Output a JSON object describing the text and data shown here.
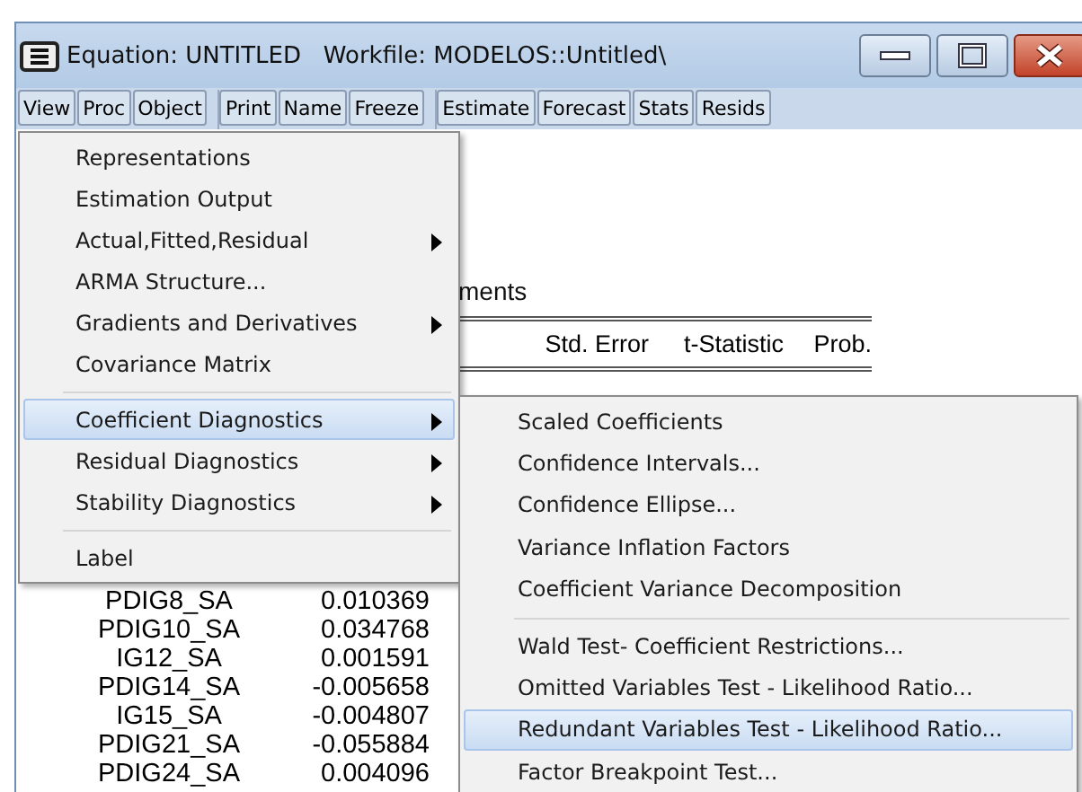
{
  "window": {
    "title": "Equation: UNTITLED   Workfile: MODELOS::Untitled\\"
  },
  "toolbar": [
    {
      "buttons": [
        "View",
        "Proc",
        "Object"
      ]
    },
    {
      "buttons": [
        "Print",
        "Name",
        "Freeze"
      ]
    },
    {
      "buttons": [
        "Estimate",
        "Forecast",
        "Stats",
        "Resids"
      ]
    }
  ],
  "output": {
    "heading_fragment": "ments",
    "table": {
      "headers": [
        "Std. Error",
        "t-Statistic",
        "Prob."
      ],
      "rows": [
        {
          "variable": "PDIG8_SA",
          "coefficient": "0.010369"
        },
        {
          "variable": "PDIG10_SA",
          "coefficient": "0.034768"
        },
        {
          "variable": "IG12_SA",
          "coefficient": "0.001591"
        },
        {
          "variable": "PDIG14_SA",
          "coefficient": "-0.005658"
        },
        {
          "variable": "IG15_SA",
          "coefficient": "-0.004807"
        },
        {
          "variable": "PDIG21_SA",
          "coefficient": "-0.055884"
        },
        {
          "variable": "PDIG24_SA",
          "coefficient": "0.004096"
        }
      ]
    }
  },
  "view_menu": {
    "items": [
      {
        "kind": "item",
        "label": "Representations",
        "submenu": false,
        "selected": false
      },
      {
        "kind": "item",
        "label": "Estimation Output",
        "submenu": false,
        "selected": false
      },
      {
        "kind": "item",
        "label": "Actual,Fitted,Residual",
        "submenu": true,
        "selected": false
      },
      {
        "kind": "item",
        "label": "ARMA Structure...",
        "submenu": false,
        "selected": false
      },
      {
        "kind": "item",
        "label": "Gradients and Derivatives",
        "submenu": true,
        "selected": false
      },
      {
        "kind": "item",
        "label": "Covariance Matrix",
        "submenu": false,
        "selected": false
      },
      {
        "kind": "separator"
      },
      {
        "kind": "item",
        "label": "Coefficient Diagnostics",
        "submenu": true,
        "selected": true
      },
      {
        "kind": "item",
        "label": "Residual Diagnostics",
        "submenu": true,
        "selected": false
      },
      {
        "kind": "item",
        "label": "Stability Diagnostics",
        "submenu": true,
        "selected": false
      },
      {
        "kind": "separator"
      },
      {
        "kind": "item",
        "label": "Label",
        "submenu": false,
        "selected": false
      }
    ]
  },
  "coefficient_submenu": {
    "items": [
      {
        "kind": "item",
        "label": "Scaled Coefficients",
        "submenu": false,
        "selected": false
      },
      {
        "kind": "item",
        "label": "Confidence Intervals...",
        "submenu": false,
        "selected": false
      },
      {
        "kind": "item",
        "label": "Confidence Ellipse...",
        "submenu": false,
        "selected": false
      },
      {
        "kind": "item",
        "label": "Variance Inflation Factors",
        "submenu": false,
        "selected": false
      },
      {
        "kind": "item",
        "label": "Coefficient Variance Decomposition",
        "submenu": false,
        "selected": false
      },
      {
        "kind": "separator"
      },
      {
        "kind": "item",
        "label": "Wald Test- Coefficient Restrictions...",
        "submenu": false,
        "selected": false
      },
      {
        "kind": "item",
        "label": "Omitted Variables Test - Likelihood Ratio...",
        "submenu": false,
        "selected": false
      },
      {
        "kind": "item",
        "label": "Redundant Variables Test - Likelihood Ratio...",
        "submenu": false,
        "selected": true
      },
      {
        "kind": "item",
        "label": "Factor Breakpoint Test...",
        "submenu": false,
        "selected": false
      }
    ]
  }
}
